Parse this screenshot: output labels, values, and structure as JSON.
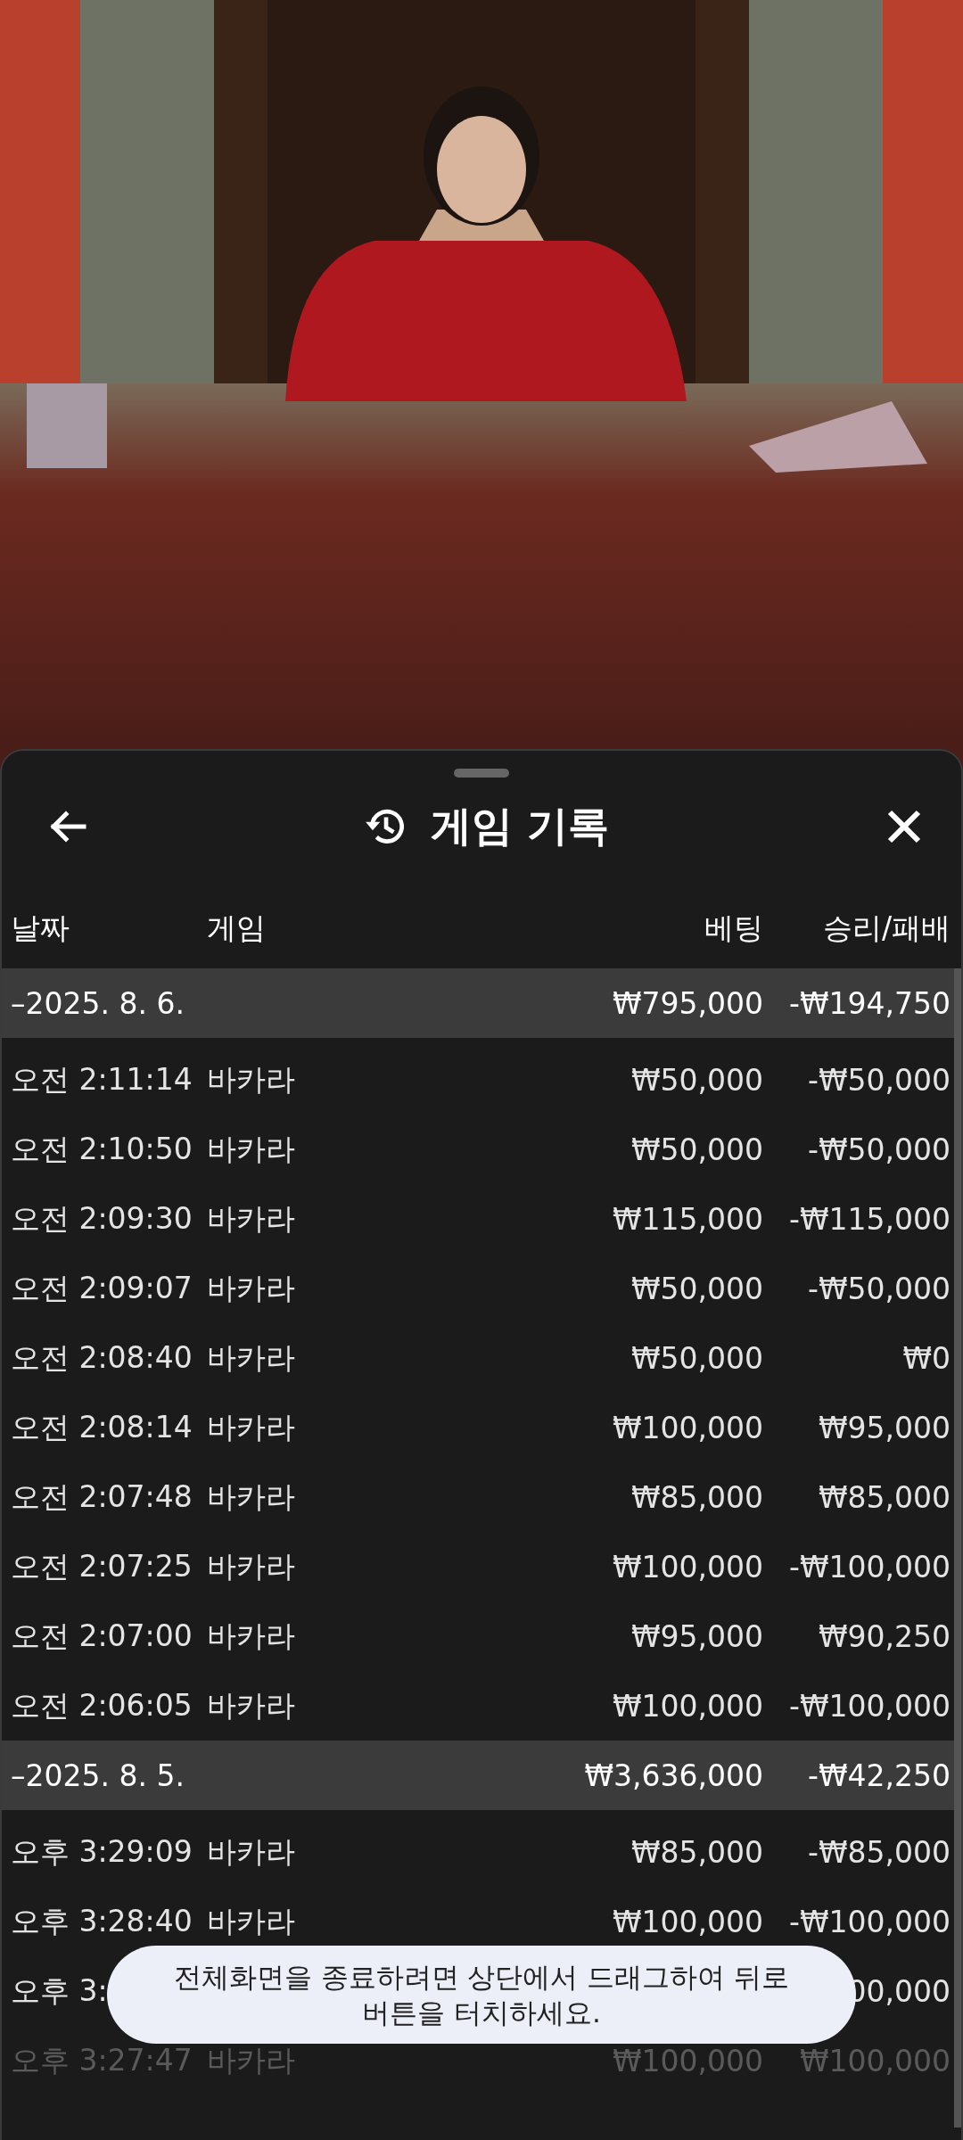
{
  "sheet": {
    "title": "게임 기록"
  },
  "table": {
    "columns": [
      "날짜",
      "게임",
      "베팅",
      "승리/패배"
    ],
    "groups": [
      {
        "date": "–2025. 8. 6.",
        "bet": "₩795,000",
        "result": "-₩194,750",
        "rows": [
          {
            "time": "오전 2:11:14",
            "game": "바카라",
            "bet": "₩50,000",
            "result": "-₩50,000",
            "faded": false
          },
          {
            "time": "오전 2:10:50",
            "game": "바카라",
            "bet": "₩50,000",
            "result": "-₩50,000",
            "faded": false
          },
          {
            "time": "오전 2:09:30",
            "game": "바카라",
            "bet": "₩115,000",
            "result": "-₩115,000",
            "faded": false
          },
          {
            "time": "오전 2:09:07",
            "game": "바카라",
            "bet": "₩50,000",
            "result": "-₩50,000",
            "faded": false
          },
          {
            "time": "오전 2:08:40",
            "game": "바카라",
            "bet": "₩50,000",
            "result": "₩0",
            "faded": false
          },
          {
            "time": "오전 2:08:14",
            "game": "바카라",
            "bet": "₩100,000",
            "result": "₩95,000",
            "faded": false
          },
          {
            "time": "오전 2:07:48",
            "game": "바카라",
            "bet": "₩85,000",
            "result": "₩85,000",
            "faded": false
          },
          {
            "time": "오전 2:07:25",
            "game": "바카라",
            "bet": "₩100,000",
            "result": "-₩100,000",
            "faded": false
          },
          {
            "time": "오전 2:07:00",
            "game": "바카라",
            "bet": "₩95,000",
            "result": "₩90,250",
            "faded": false
          },
          {
            "time": "오전 2:06:05",
            "game": "바카라",
            "bet": "₩100,000",
            "result": "-₩100,000",
            "faded": false
          }
        ]
      },
      {
        "date": "–2025. 8. 5.",
        "bet": "₩3,636,000",
        "result": "-₩42,250",
        "rows": [
          {
            "time": "오후 3:29:09",
            "game": "바카라",
            "bet": "₩85,000",
            "result": "-₩85,000",
            "faded": false
          },
          {
            "time": "오후 3:28:40",
            "game": "바카라",
            "bet": "₩100,000",
            "result": "-₩100,000",
            "faded": false
          },
          {
            "time": "오후 3:",
            "result": "00,000",
            "faded": false
          },
          {
            "time": "오후 3:27:47",
            "game": "바카라",
            "bet": "₩100,000",
            "result": "₩100,000",
            "faded": true
          }
        ]
      }
    ]
  },
  "toast": {
    "text": "전체화면을 종료하려면 상단에서 드래그하여 뒤로 버튼을 터치하세요."
  }
}
